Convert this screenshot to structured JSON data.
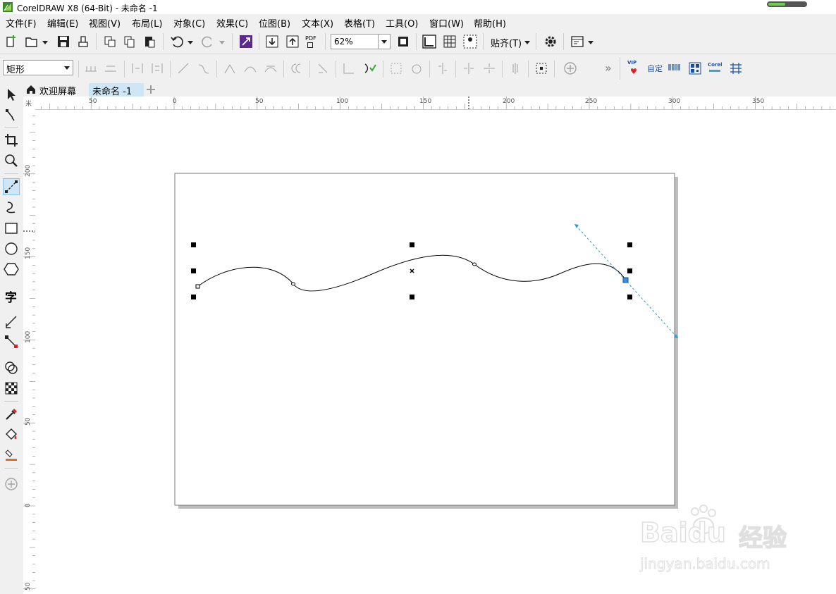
{
  "window": {
    "title": "CorelDRAW X8 (64-Bit) - 未命名 -1"
  },
  "menu": [
    "文件(F)",
    "编辑(E)",
    "视图(V)",
    "布局(L)",
    "对象(C)",
    "效果(C)",
    "位图(B)",
    "文本(X)",
    "表格(T)",
    "工具(O)",
    "窗口(W)",
    "帮助(H)"
  ],
  "toolbar": {
    "zoom_value": "62%",
    "pdf_label": "PDF",
    "snap_label": "贴齐(T)",
    "icons": [
      "new-document-icon",
      "open-folder-icon",
      "save-icon",
      "print-icon",
      "cut-icon",
      "copy-icon",
      "paste-icon",
      "undo-icon",
      "redo-icon",
      "corel-connect-icon",
      "import-icon",
      "export-icon",
      "publish-pdf-icon",
      "zoom-combo",
      "full-screen-icon",
      "show-rulers-icon",
      "show-grid-icon",
      "show-guidelines-icon",
      "snap-to-dropdown",
      "options-gear-icon",
      "app-launcher-icon"
    ]
  },
  "propertybar": {
    "object_type": "矩形",
    "more_label": "»",
    "vip_label": "VIP",
    "custom_label": "自定",
    "corel_label": "Corel"
  },
  "tabs": [
    {
      "label": "欢迎屏幕",
      "icon": "home-icon",
      "active": false
    },
    {
      "label": "未命名 -1",
      "active": true
    }
  ],
  "toolbox": {
    "icons": [
      "pick-tool-icon",
      "shape-tool-icon",
      "crop-tool-icon",
      "zoom-tool-icon",
      "freehand-tool-icon",
      "artistic-media-icon",
      "rectangle-tool-icon",
      "ellipse-tool-icon",
      "polygon-tool-icon",
      "text-tool-icon",
      "parallel-dimension-icon",
      "connector-tool-icon",
      "shadow-tool-icon",
      "transparency-tool-icon",
      "eyedropper-tool-icon",
      "interactive-fill-icon",
      "smart-fill-icon",
      "add-tool-icon"
    ],
    "text_tool_glyph": "字",
    "active_tool": "freehand-tool-icon"
  },
  "rulers": {
    "horizontal_labels": [
      "50",
      "0",
      "50",
      "100",
      "150",
      "200",
      "250",
      "300",
      "350"
    ],
    "vertical_labels": [
      "200",
      "150",
      "100",
      "50",
      "0",
      "50"
    ],
    "unit_glyph": "米"
  },
  "watermark": {
    "brand": "Baidu",
    "cn": "经验",
    "url": "jingyan.baidu.com"
  },
  "colors": {
    "accent": "#3ea2d6",
    "handle": "#000000",
    "guide": "#2d9cd4",
    "page_shadow": "#bdbdbd"
  }
}
